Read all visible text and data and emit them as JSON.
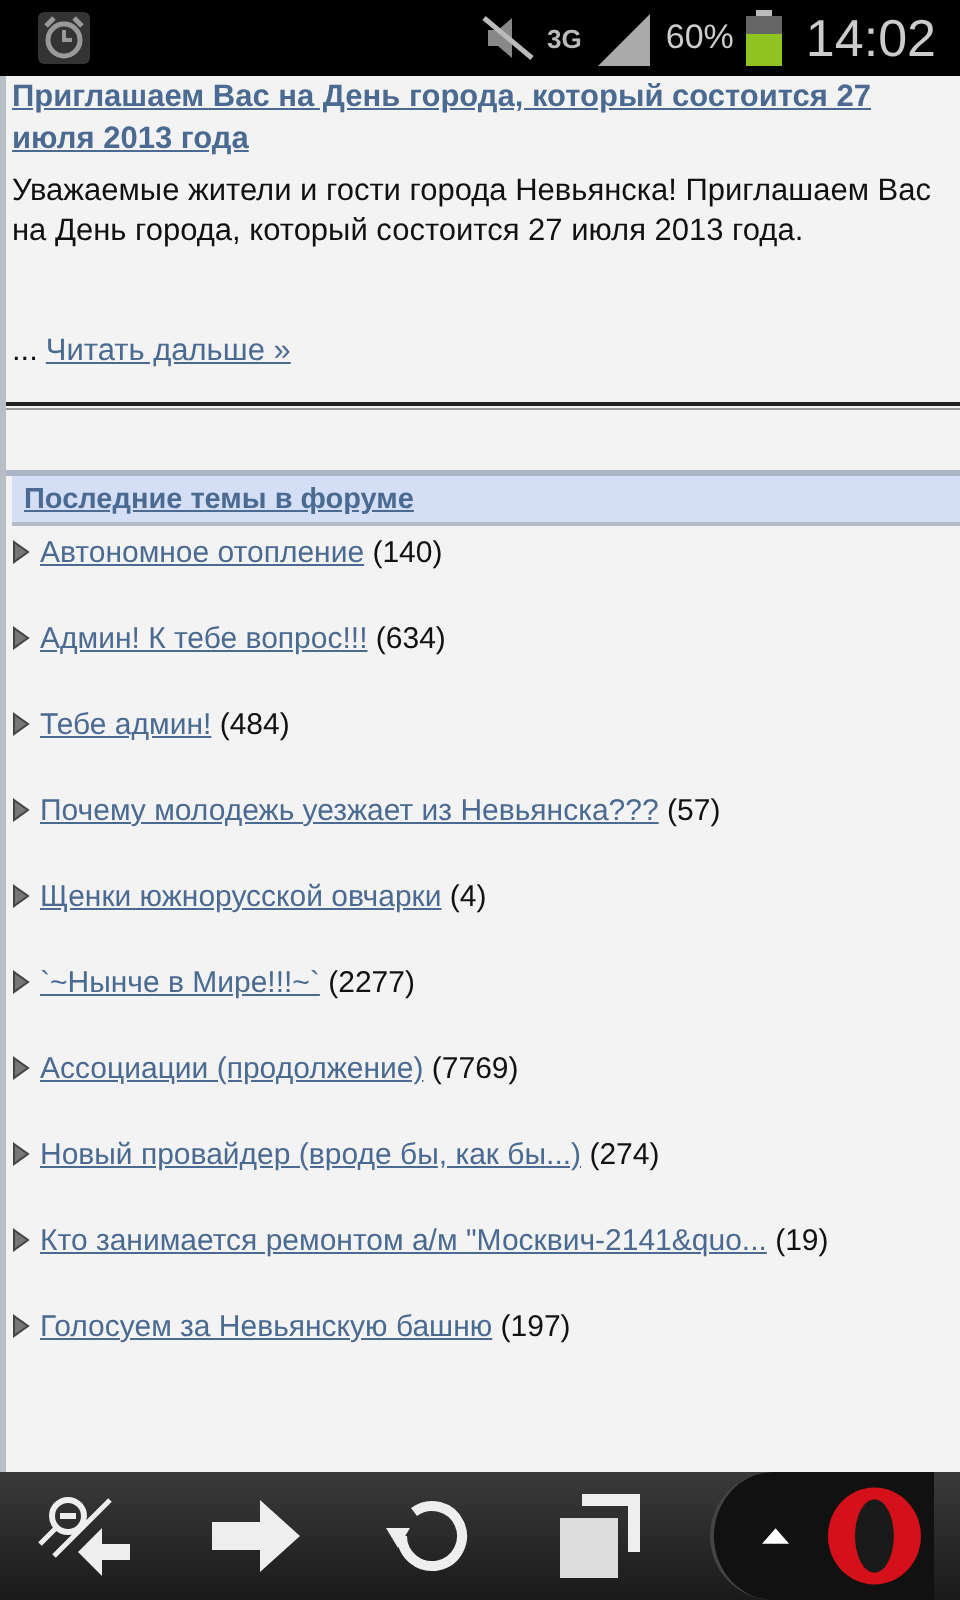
{
  "status_bar": {
    "network": "3G",
    "battery": "60%",
    "time": "14:02"
  },
  "article": {
    "title": "Приглашаем Вас на День города, который состоится 27 июля 2013 года",
    "body": "Уважаемые жители и гости города Невьянска! Приглашаем Вас на День города, который состоится 27 июля 2013 года.",
    "ellipsis": "...",
    "read_more": "Читать дальше »"
  },
  "forum": {
    "heading": "Последние темы в форуме",
    "topics": [
      {
        "title": "Автономное отопление",
        "count": "(140)"
      },
      {
        "title": "Админ! К тебе вопрос!!!",
        "count": "(634)"
      },
      {
        "title": "Тебе админ!",
        "count": "(484)"
      },
      {
        "title": "Почему молодежь уезжает из Невьянска???",
        "count": "(57)"
      },
      {
        "title": "Щенки южнорусской овчарки",
        "count": "(4)"
      },
      {
        "title": "`~Нынче в Мире!!!~`",
        "count": "(2277)"
      },
      {
        "title": "Ассоциации (продолжение)",
        "count": "(7769)"
      },
      {
        "title": "Новый провайдер (вроде бы, как бы...)",
        "count": "(274)"
      },
      {
        "title": "Кто занимается ремонтом а/м \"Москвич-2141&quo...",
        "count": "(19)"
      },
      {
        "title": "Голосуем за Невьянскую башню",
        "count": "(197)"
      }
    ]
  }
}
